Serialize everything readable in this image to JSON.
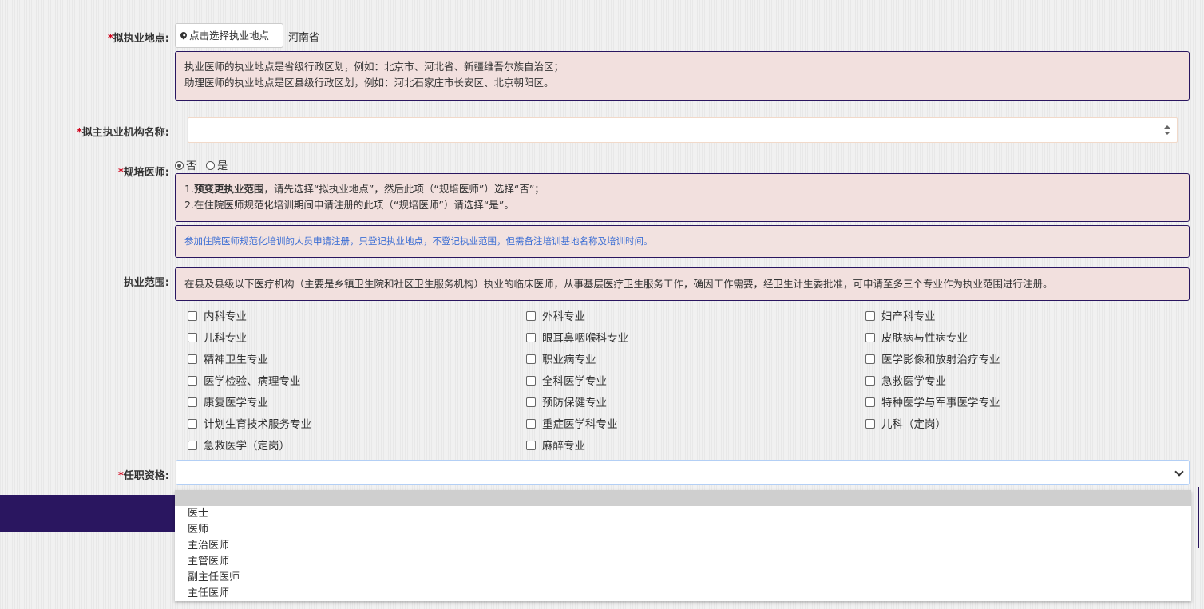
{
  "practice_location": {
    "label": "拟执业地点:",
    "required_mark": "*",
    "button_label": "点击选择执业地点",
    "button_icon": "map-pin-icon",
    "selected_value": "河南省",
    "info_lines": [
      "执业医师的执业地点是省级行政区划，例如：北京市、河北省、新疆维吾尔族自治区；",
      "助理医师的执业地点是区县级行政区划，例如：河北石家庄市长安区、北京朝阳区。"
    ]
  },
  "institution": {
    "label": "拟主执业机构名称:",
    "required_mark": "*",
    "value": ""
  },
  "resident_doctor": {
    "label": "规培医师:",
    "required_mark": "*",
    "options": [
      "否",
      "是"
    ],
    "selected": "否",
    "info_line1_prefix": "1.",
    "info_line1_bold": "预变更执业范围",
    "info_line1_rest": "，请先选择“拟执业地点”，然后此项（“规培医师”）选择“否”；",
    "info_line2": "2.在住院医师规范化培训期间申请注册的此项（“规培医师”）请选择“是”。",
    "note": "参加住院医师规范化培训的人员申请注册，只登记执业地点，不登记执业范围，但需备注培训基地名称及培训时间。"
  },
  "practice_scope": {
    "label": "执业范围:",
    "info": "在县及县级以下医疗机构（主要是乡镇卫生院和社区卫生服务机构）执业的临床医师，从事基层医疗卫生服务工作，确因工作需要，经卫生计生委批准，可申请至多三个专业作为执业范围进行注册。",
    "columns": [
      [
        "内科专业",
        "儿科专业",
        "精神卫生专业",
        "医学检验、病理专业",
        "康复医学专业",
        "计划生育技术服务专业",
        "急救医学（定岗）"
      ],
      [
        "外科专业",
        "眼耳鼻咽喉科专业",
        "职业病专业",
        "全科医学专业",
        "预防保健专业",
        "重症医学科专业",
        "麻醉专业"
      ],
      [
        "妇产科专业",
        "皮肤病与性病专业",
        "医学影像和放射治疗专业",
        "急救医学专业",
        "特种医学与军事医学专业",
        "儿科（定岗）"
      ]
    ]
  },
  "qualification": {
    "label": "任职资格:",
    "required_mark": "*",
    "value": "",
    "options": [
      "",
      "医士",
      "医师",
      "主治医师",
      "主管医师",
      "副主任医师",
      "主任医师"
    ]
  },
  "colors": {
    "accent": "#2a1660",
    "info_bg": "#f2e0de",
    "required": "#d0021b",
    "note_text": "#3d6fd4"
  }
}
